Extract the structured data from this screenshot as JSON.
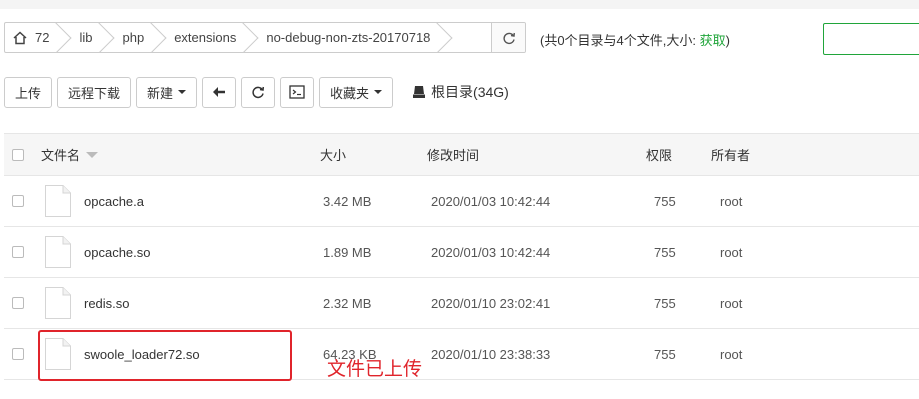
{
  "breadcrumb": {
    "items": [
      {
        "label": "72"
      },
      {
        "label": "lib"
      },
      {
        "label": "php"
      },
      {
        "label": "extensions"
      },
      {
        "label": "no-debug-non-zts-20170718"
      }
    ]
  },
  "summary": {
    "text": "(共0个目录与4个文件,大小: ",
    "link": "获取",
    "suffix": ")"
  },
  "toolbar": {
    "upload": "上传",
    "remote_download": "远程下载",
    "new": "新建",
    "favorites": "收藏夹",
    "root": "根目录(34G)"
  },
  "table": {
    "headers": {
      "name": "文件名",
      "size": "大小",
      "modified": "修改时间",
      "permission": "权限",
      "owner": "所有者"
    },
    "rows": [
      {
        "name": "opcache.a",
        "size": "3.42 MB",
        "modified": "2020/01/03 10:42:44",
        "permission": "755",
        "owner": "root"
      },
      {
        "name": "opcache.so",
        "size": "1.89 MB",
        "modified": "2020/01/03 10:42:44",
        "permission": "755",
        "owner": "root"
      },
      {
        "name": "redis.so",
        "size": "2.32 MB",
        "modified": "2020/01/10 23:02:41",
        "permission": "755",
        "owner": "root"
      },
      {
        "name": "swoole_loader72.so",
        "size": "64.23 KB",
        "modified": "2020/01/10 23:38:33",
        "permission": "755",
        "owner": "root"
      }
    ]
  },
  "annotation": {
    "text": "文件已上传",
    "color": "#e0242b"
  },
  "colors": {
    "accent": "#20a53a",
    "highlight": "#e0242b"
  },
  "icons": [
    "home-icon",
    "refresh-icon",
    "back-arrow-icon",
    "terminal-icon",
    "drive-icon",
    "file-icon",
    "sort-caret-icon"
  ]
}
